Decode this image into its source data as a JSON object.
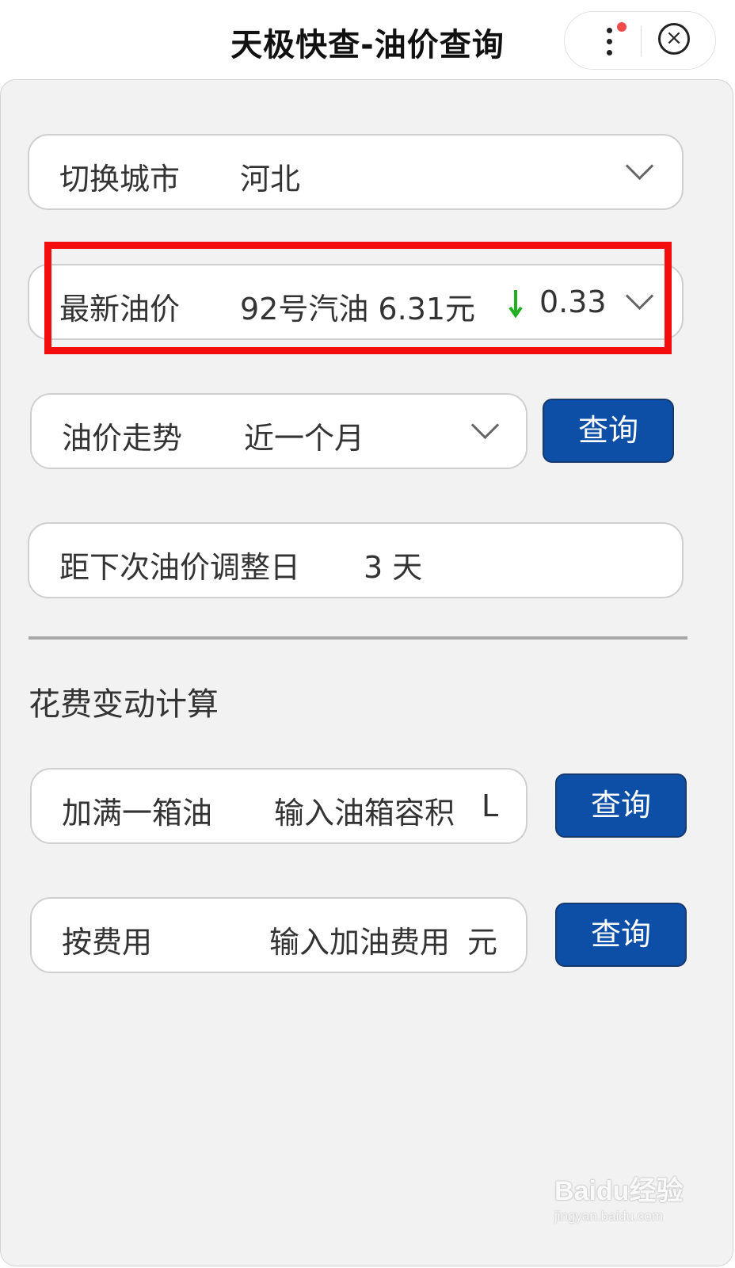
{
  "app": {
    "title": "天极快查-油价查询"
  },
  "city": {
    "label": "切换城市",
    "value": "河北"
  },
  "latest_price": {
    "label": "最新油价",
    "value": "92号汽油 6.31元",
    "change": "0.33",
    "change_direction": "down",
    "change_color": "#22b022"
  },
  "trend": {
    "label": "油价走势",
    "value": "近一个月",
    "button": "查询"
  },
  "next_adjust": {
    "label": "距下次油价调整日",
    "value": "3 天"
  },
  "calc": {
    "title": "花费变动计算",
    "full_tank": {
      "label": "加满一箱油",
      "placeholder": "输入油箱容积",
      "unit": "L",
      "button": "查询"
    },
    "by_cost": {
      "label": "按费用",
      "placeholder": "输入加油费用",
      "unit": "元",
      "button": "查询"
    }
  },
  "colors": {
    "accent": "#0d4ea6",
    "highlight": "#f40d0d"
  },
  "watermark": {
    "main": "Baidu经验",
    "sub": "jingyan.baidu.com"
  }
}
